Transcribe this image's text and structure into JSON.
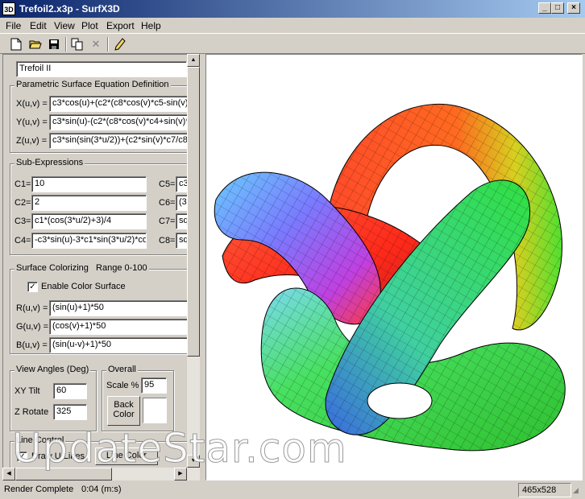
{
  "window": {
    "title": "Trefoil2.x3p - SurfX3D",
    "app_icon_text": "3D",
    "minimize_icon": "_",
    "maximize_icon": "□",
    "close_icon": "×"
  },
  "menu": [
    "File",
    "Edit",
    "View",
    "Plot",
    "Export",
    "Help"
  ],
  "toolbar": {
    "icons": [
      "new-file-icon",
      "open-folder-icon",
      "save-disk-icon",
      "copy-icon",
      "delete-x-icon",
      "pencil-icon"
    ]
  },
  "surface_name": "Trefoil II",
  "equations": {
    "group_label": "Parametric Surface Equation Definition",
    "x_label": "X(u,v) =",
    "x_value": "c3*cos(u)+(c2*(c8*cos(v)*c5-sin(v)*",
    "y_label": "Y(u,v) =",
    "y_value": "c3*sin(u)-(c2*(c8*cos(v)*c4+sin(v)*c",
    "z_label": "Z(u,v) =",
    "z_value": "c3*sin(sin(3*u/2))+(c2*sin(v)*c7/c8)"
  },
  "subexpr": {
    "group_label": "Sub-Expressions",
    "c1_label": "C1=",
    "c1_value": "10",
    "c2_label": "C2=",
    "c2_value": "2",
    "c3_label": "C3=",
    "c3_value": "c1*(cos(3*u/2)+3)/4",
    "c4_label": "C4=",
    "c4_value": "-c3*sin(u)-3*c1*sin(3*u/2)*co",
    "c5_label": "C5=",
    "c5_value": "c3",
    "c6_label": "C6=",
    "c6_value": "(3*",
    "c7_label": "C7=",
    "c7_value": "squ",
    "c8_label": "C8=",
    "c8_value": "squ"
  },
  "colorizing": {
    "group_label": "Surface Colorizing",
    "range_label": "Range 0-100",
    "enable_label": "Enable Color Surface",
    "enable_checked": "✓",
    "r_label": "R(u,v) =",
    "r_value": "(sin(u)+1)*50",
    "g_label": "G(u,v) =",
    "g_value": "(cos(v)+1)*50",
    "b_label": "B(u,v) =",
    "b_value": "(sin(u-v)+1)*50"
  },
  "view_angles": {
    "group_label": "View Angles (Deg)",
    "xy_tilt_label": "XY Tilt",
    "xy_tilt_value": "60",
    "z_rotate_label": "Z Rotate",
    "z_rotate_value": "325"
  },
  "overall": {
    "group_label": "Overall",
    "scale_label": "Scale %",
    "scale_value": "95",
    "back_color_label": "Back Color",
    "back_color_swatch": "#ffffff"
  },
  "line_control": {
    "group_label": "Line Control",
    "draw_u_label": "Draw U Lines",
    "draw_u_checked": "✓",
    "line_color_label": "Line Color"
  },
  "status": {
    "message": "Render Complete",
    "time": "0:04 (m:s)",
    "size": "465x528"
  },
  "watermark": "UpdateStar.com",
  "colors": {
    "title_start": "#0a246a",
    "title_end": "#a6caf0",
    "face": "#d4d0c8"
  }
}
